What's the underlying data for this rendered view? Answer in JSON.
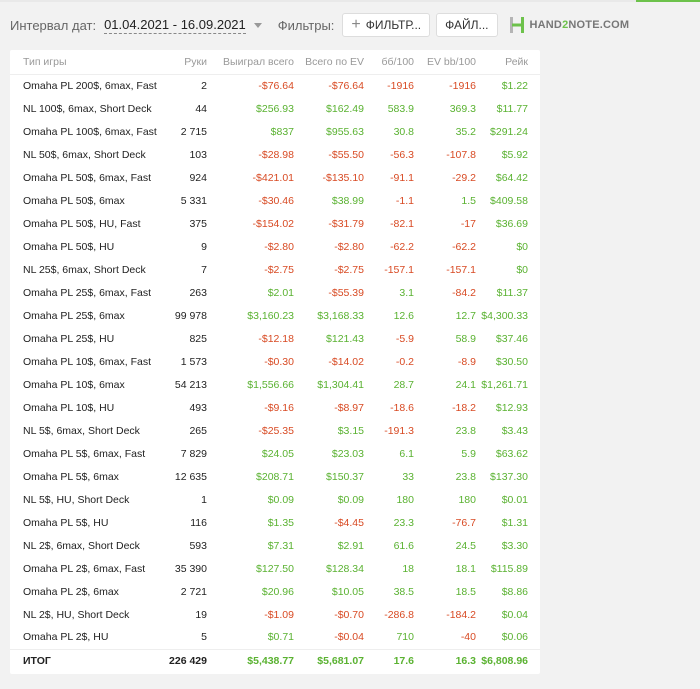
{
  "toolbar": {
    "date_label": "Интервал дат:",
    "date_range": "01.04.2021 - 16.09.2021",
    "filters_label": "Фильтры:",
    "filter_button": "ФИЛЬТР...",
    "file_button": "ФАЙЛ...",
    "logo": {
      "part1": "HAND",
      "part2": "2",
      "part3": "NOTE.COM"
    },
    "colors": {
      "accent": "#6dc24b",
      "positive": "#5ab231",
      "negative": "#d84a23"
    }
  },
  "table": {
    "headers": [
      "Тип игры",
      "Руки",
      "Выиграл всего",
      "Всего по EV",
      "бб/100",
      "EV bb/100",
      "Рейк"
    ],
    "rows": [
      [
        "Omaha PL 200$, 6max, Fast",
        "2",
        "-$76.64",
        "-$76.64",
        "-1916",
        "-1916",
        "$1.22"
      ],
      [
        "NL 100$, 6max, Short Deck",
        "44",
        "$256.93",
        "$162.49",
        "583.9",
        "369.3",
        "$11.77"
      ],
      [
        "Omaha PL 100$, 6max, Fast",
        "2 715",
        "$837",
        "$955.63",
        "30.8",
        "35.2",
        "$291.24"
      ],
      [
        "NL 50$, 6max, Short Deck",
        "103",
        "-$28.98",
        "-$55.50",
        "-56.3",
        "-107.8",
        "$5.92"
      ],
      [
        "Omaha PL 50$, 6max, Fast",
        "924",
        "-$421.01",
        "-$135.10",
        "-91.1",
        "-29.2",
        "$64.42"
      ],
      [
        "Omaha PL 50$, 6max",
        "5 331",
        "-$30.46",
        "$38.99",
        "-1.1",
        "1.5",
        "$409.58"
      ],
      [
        "Omaha PL 50$, HU, Fast",
        "375",
        "-$154.02",
        "-$31.79",
        "-82.1",
        "-17",
        "$36.69"
      ],
      [
        "Omaha PL 50$, HU",
        "9",
        "-$2.80",
        "-$2.80",
        "-62.2",
        "-62.2",
        "$0"
      ],
      [
        "NL 25$, 6max, Short Deck",
        "7",
        "-$2.75",
        "-$2.75",
        "-157.1",
        "-157.1",
        "$0"
      ],
      [
        "Omaha PL 25$, 6max, Fast",
        "263",
        "$2.01",
        "-$55.39",
        "3.1",
        "-84.2",
        "$11.37"
      ],
      [
        "Omaha PL 25$, 6max",
        "99 978",
        "$3,160.23",
        "$3,168.33",
        "12.6",
        "12.7",
        "$4,300.33"
      ],
      [
        "Omaha PL 25$, HU",
        "825",
        "-$12.18",
        "$121.43",
        "-5.9",
        "58.9",
        "$37.46"
      ],
      [
        "Omaha PL 10$, 6max, Fast",
        "1 573",
        "-$0.30",
        "-$14.02",
        "-0.2",
        "-8.9",
        "$30.50"
      ],
      [
        "Omaha PL 10$, 6max",
        "54 213",
        "$1,556.66",
        "$1,304.41",
        "28.7",
        "24.1",
        "$1,261.71"
      ],
      [
        "Omaha PL 10$, HU",
        "493",
        "-$9.16",
        "-$8.97",
        "-18.6",
        "-18.2",
        "$12.93"
      ],
      [
        "NL 5$, 6max, Short Deck",
        "265",
        "-$25.35",
        "$3.15",
        "-191.3",
        "23.8",
        "$3.43"
      ],
      [
        "Omaha PL 5$, 6max, Fast",
        "7 829",
        "$24.05",
        "$23.03",
        "6.1",
        "5.9",
        "$63.62"
      ],
      [
        "Omaha PL 5$, 6max",
        "12 635",
        "$208.71",
        "$150.37",
        "33",
        "23.8",
        "$137.30"
      ],
      [
        "NL 5$, HU, Short Deck",
        "1",
        "$0.09",
        "$0.09",
        "180",
        "180",
        "$0.01"
      ],
      [
        "Omaha PL 5$, HU",
        "116",
        "$1.35",
        "-$4.45",
        "23.3",
        "-76.7",
        "$1.31"
      ],
      [
        "NL 2$, 6max, Short Deck",
        "593",
        "$7.31",
        "$2.91",
        "61.6",
        "24.5",
        "$3.30"
      ],
      [
        "Omaha PL 2$, 6max, Fast",
        "35 390",
        "$127.50",
        "$128.34",
        "18",
        "18.1",
        "$115.89"
      ],
      [
        "Omaha PL 2$, 6max",
        "2 721",
        "$20.96",
        "$10.05",
        "38.5",
        "18.5",
        "$8.86"
      ],
      [
        "NL 2$, HU, Short Deck",
        "19",
        "-$1.09",
        "-$0.70",
        "-286.8",
        "-184.2",
        "$0.04"
      ],
      [
        "Omaha PL 2$, HU",
        "5",
        "$0.71",
        "-$0.04",
        "710",
        "-40",
        "$0.06"
      ]
    ],
    "total": [
      "ИТОГ",
      "226 429",
      "$5,438.77",
      "$5,681.07",
      "17.6",
      "16.3",
      "$6,808.96"
    ]
  }
}
